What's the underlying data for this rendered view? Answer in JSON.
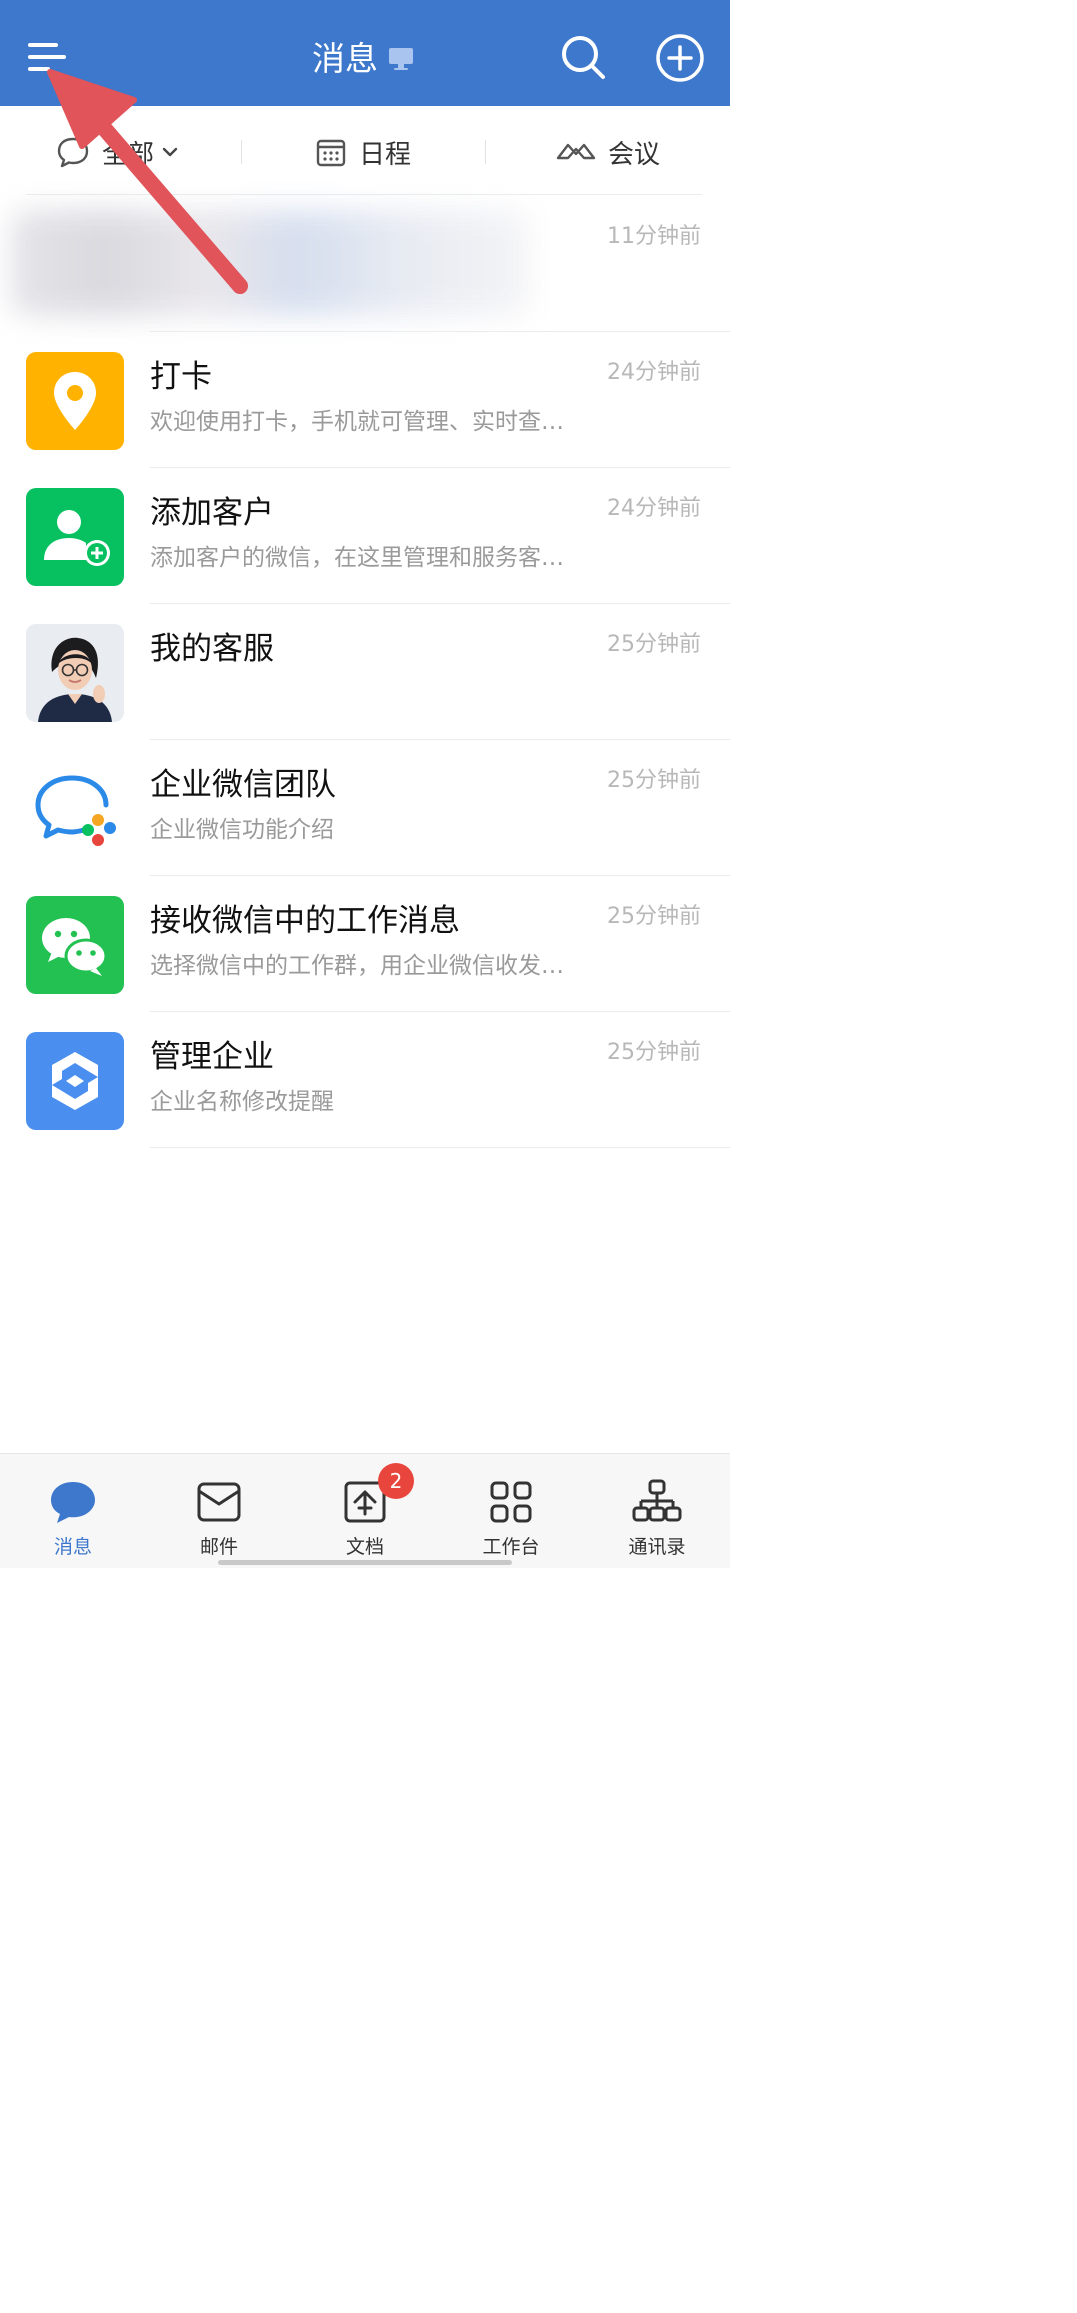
{
  "header": {
    "title": "消息"
  },
  "filters": {
    "all_label": "全部",
    "schedule_label": "日程",
    "meeting_label": "会议"
  },
  "messages": [
    {
      "time": "11分钟前"
    },
    {
      "title": "打卡",
      "preview": "欢迎使用打卡，手机就可管理、实时查…",
      "time": "24分钟前"
    },
    {
      "title": "添加客户",
      "preview": "添加客户的微信，在这里管理和服务客…",
      "time": "24分钟前"
    },
    {
      "title": "我的客服",
      "preview": "",
      "time": "25分钟前"
    },
    {
      "title": "企业微信团队",
      "preview": "企业微信功能介绍",
      "time": "25分钟前"
    },
    {
      "title": "接收微信中的工作消息",
      "preview": "选择微信中的工作群，用企业微信收发…",
      "time": "25分钟前"
    },
    {
      "title": "管理企业",
      "preview": "企业名称修改提醒",
      "time": "25分钟前"
    }
  ],
  "tabbar": {
    "tabs": [
      {
        "label": "消息",
        "icon": "chat-bubble-icon",
        "active": true
      },
      {
        "label": "邮件",
        "icon": "mail-icon",
        "active": false
      },
      {
        "label": "文档",
        "icon": "document-icon",
        "active": false,
        "badge": "2"
      },
      {
        "label": "工作台",
        "icon": "grid-icon",
        "active": false
      },
      {
        "label": "通讯录",
        "icon": "org-chart-icon",
        "active": false
      }
    ]
  },
  "colors": {
    "header_bg": "#3d78cc",
    "accent": "#3d78cc",
    "badge": "#e8463d",
    "annotation_arrow": "#e0545a"
  }
}
